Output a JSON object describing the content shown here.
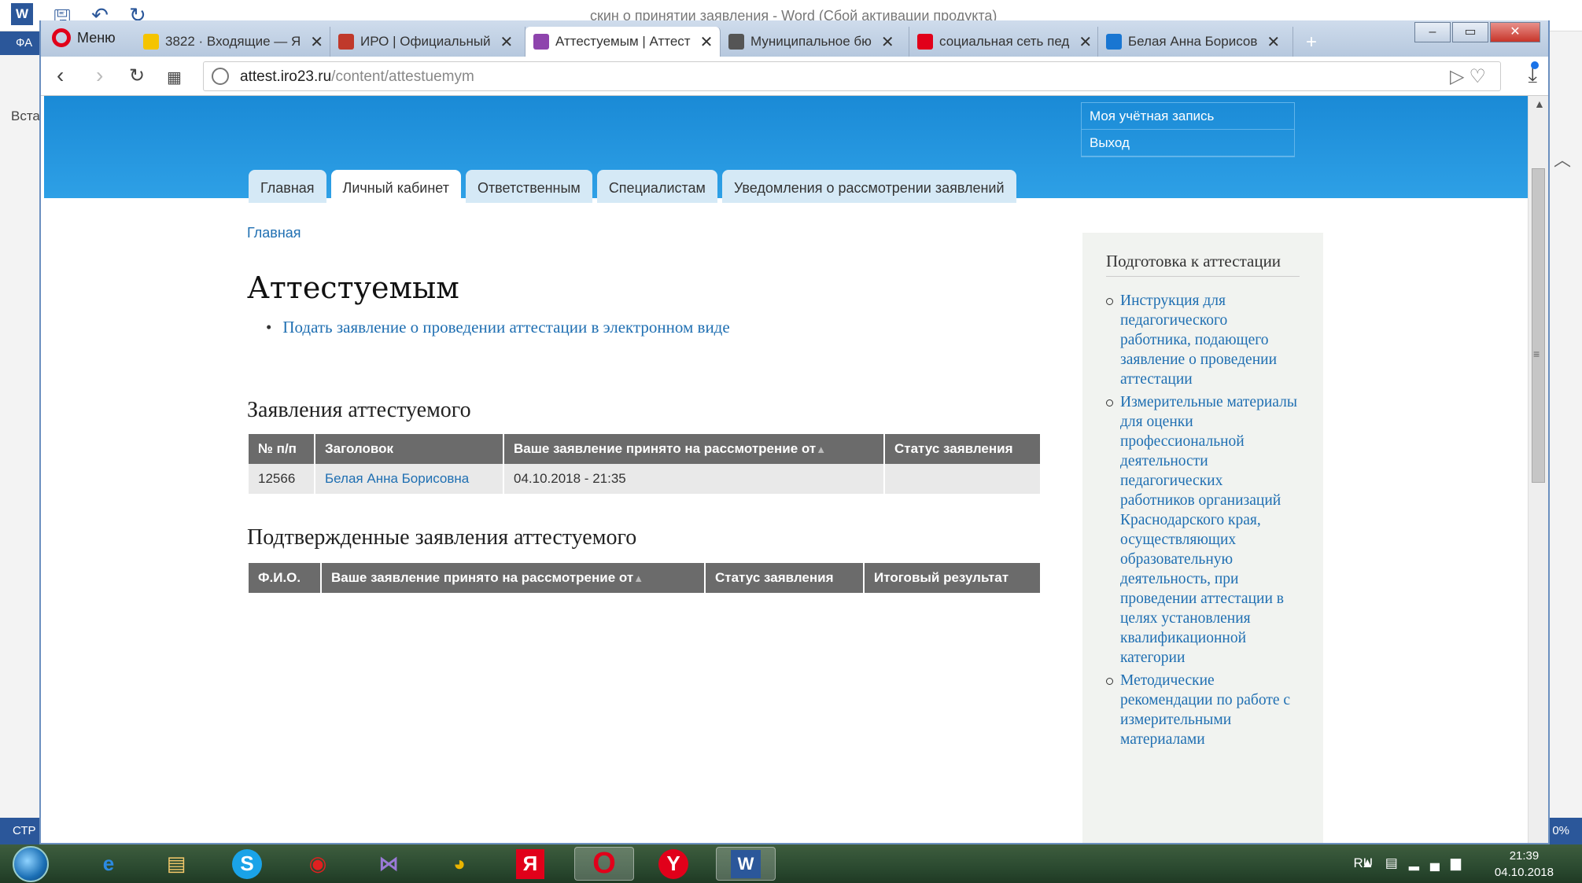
{
  "word": {
    "title": "скин о принятии заявления - Word (Сбой активации продукта)",
    "ribbon_tab": "ФА",
    "paste_label": "Вста",
    "status_left": "СТР",
    "status_zoom": "0%"
  },
  "browser": {
    "menu_label": "Меню",
    "tabs": [
      {
        "label": "3822 · Входящие — Я",
        "icon_color": "#e53935"
      },
      {
        "label": "ИРО | Официальный",
        "icon_color": "#c0392b"
      },
      {
        "label": "Аттестуемым | Аттест",
        "icon_color": "#8e44ad"
      },
      {
        "label": "Муниципальное бю",
        "icon_color": "#555555"
      },
      {
        "label": "социальная сеть пед",
        "icon_color": "#e1001a"
      },
      {
        "label": "Белая Анна Борисов",
        "icon_color": "#1976d2"
      }
    ],
    "url_host": "attest.iro23.ru",
    "url_path": "/content/attestuemym"
  },
  "site": {
    "user_menu": [
      "Моя учётная запись",
      "Выход"
    ],
    "main_tabs": [
      "Главная",
      "Личный кабинет",
      "Ответственным",
      "Специалистам",
      "Уведомления о рассмотрении заявлений"
    ],
    "active_tab": 1,
    "breadcrumb": "Главная",
    "page_title": "Аттестуемым",
    "action_link": "Подать заявление о проведении аттестации в электронном виде",
    "applications": {
      "title": "Заявления аттестуемого",
      "headers": [
        "№ п/п",
        "Заголовок",
        "Ваше заявление принято на рассмотрение от",
        "Статус заявления"
      ],
      "rows": [
        [
          "12566",
          "Белая Анна Борисовна",
          "04.10.2018 - 21:35",
          ""
        ]
      ]
    },
    "confirmed": {
      "title": "Подтвержденные заявления аттестуемого",
      "headers": [
        "Ф.И.О.",
        "Ваше заявление принято на рассмотрение от",
        "Статус заявления",
        "Итоговый результат"
      ]
    },
    "sidebar": {
      "title": "Подготовка к аттестации",
      "items": [
        "Инструкция для педагогического работника, подающего заявление о проведении аттестации",
        "Измерительные материалы для оценки профессиональной деятельности педагогических работников организаций Краснодарского края, осуществляющих образовательную деятельность, при проведении аттестации в целях установления квалификационной категории",
        "Методические рекомендации по работе с измерительными материалами"
      ]
    }
  },
  "taskbar": {
    "lang": "RU",
    "time": "21:39",
    "date": "04.10.2018",
    "apps": [
      "ie-icon",
      "explorer-icon",
      "skype-icon",
      "app-red-icon",
      "app-purple-icon",
      "chrome-icon",
      "yandex-icon",
      "opera-icon",
      "yandex-browser-icon",
      "word-icon"
    ]
  }
}
